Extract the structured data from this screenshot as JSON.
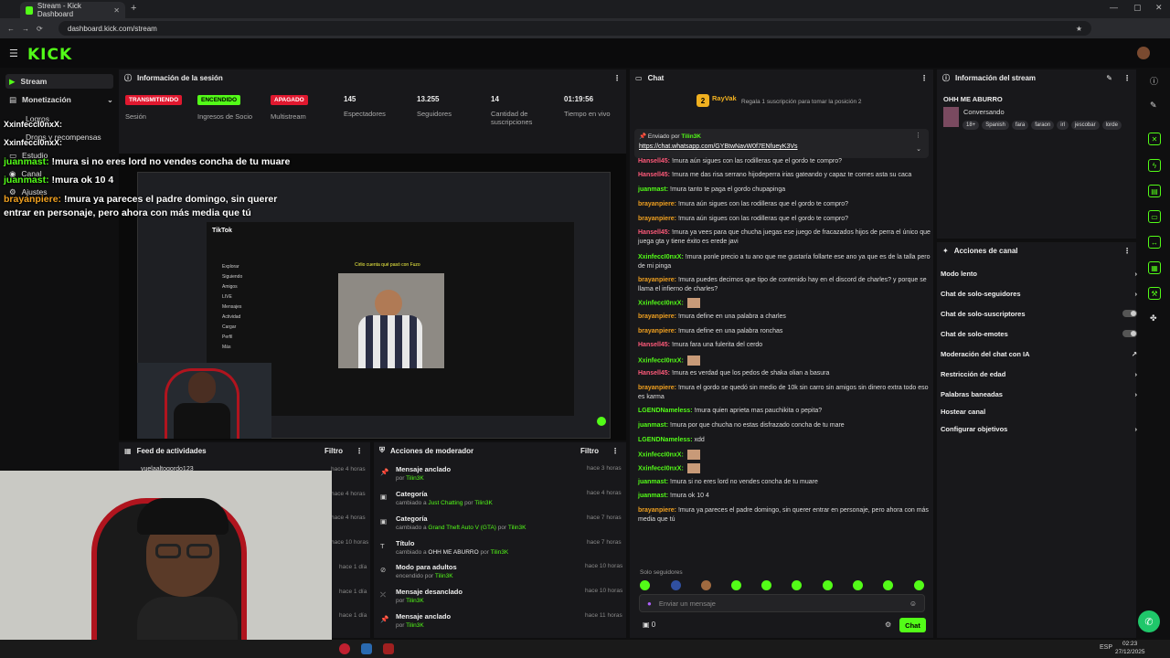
{
  "browser": {
    "tab_title": "Stream - Kick Dashboard",
    "url": "dashboard.kick.com/stream",
    "clock": "02:23",
    "date": "27/12/2025",
    "lang": "ESP"
  },
  "brand": {
    "logo": "KICK",
    "accent": "#53fc18"
  },
  "sidebar": {
    "items": [
      {
        "label": "Stream",
        "icon": "home-icon"
      },
      {
        "label": "Monetización",
        "icon": "dollar-icon"
      },
      {
        "label": "Logros",
        "icon": "trophy-icon"
      },
      {
        "label": "Drops y recompensas",
        "icon": "gift-icon"
      },
      {
        "label": "Estudio",
        "icon": "video-icon"
      },
      {
        "label": "Canal",
        "icon": "user-icon"
      },
      {
        "label": "Ajustes",
        "icon": "gear-icon"
      }
    ]
  },
  "session": {
    "title": "Información de la sesión",
    "stats": [
      {
        "value": "TRANSMITIENDO",
        "label": "Sesión"
      },
      {
        "value": "ENCENDIDO",
        "label": "Ingresos de Socio"
      },
      {
        "value": "APAGADO",
        "label": "Multistream"
      },
      {
        "value": "145",
        "label": "Espectadores"
      },
      {
        "value": "13.255",
        "label": "Seguidores"
      },
      {
        "value": "14",
        "label": "Cantidad de suscripciones"
      },
      {
        "value": "01:19:56",
        "label": "Tiempo en vivo"
      }
    ]
  },
  "overlay": [
    {
      "user": "XxinfeccI0nxX:",
      "text": ""
    },
    {
      "user": "XxinfeccI0nxX:",
      "text": ""
    },
    {
      "user": "juanmast:",
      "text": "!mura si no eres lord no vendes concha de tu muare"
    },
    {
      "user": "juanmast:",
      "text": "!mura ok 10 4"
    },
    {
      "user": "brayanpiere:",
      "text": "!mura ya pareces el padre domingo, sin querer entrar en personaje, pero ahora con más media que tú"
    }
  ],
  "embedded": {
    "tiktok": "TikTok",
    "caption": "Cirlio cuenta qué pasó con Fuzo",
    "menu": [
      "Explorar",
      "Siguiendo",
      "Amigos",
      "LIVE",
      "Mensajes",
      "Actividad",
      "Cargar",
      "Perfil",
      "Más"
    ]
  },
  "feed": {
    "title": "Feed de actividades",
    "filter": "Filtro",
    "rows": [
      {
        "user": "vuelaaltogordo123",
        "time": "hace 4 horas"
      },
      {
        "user": "",
        "time": "hace 4 horas"
      },
      {
        "user": "",
        "time": "hace 4 horas"
      },
      {
        "user": "",
        "time": "hace 10 horas"
      },
      {
        "user": "",
        "time": "hace 1 día"
      },
      {
        "user": "",
        "time": "hace 1 día"
      },
      {
        "user": "",
        "time": "hace 1 día"
      }
    ]
  },
  "mod": {
    "title": "Acciones de moderador",
    "filter": "Filtro",
    "rows": [
      {
        "title": "Mensaje anclado",
        "pre": "por",
        "value": "",
        "by": "Tilin3K",
        "time": "hace 3 horas",
        "icon": "pin-icon"
      },
      {
        "title": "Categoría",
        "pre": "cambiado a",
        "value": "Just Chatting",
        "by": "Tilin3K",
        "time": "hace 4 horas",
        "icon": "category-icon"
      },
      {
        "title": "Categoría",
        "pre": "cambiado a",
        "value": "Grand Theft Auto V (GTA)",
        "by": "Tilin3K",
        "time": "hace 7 horas",
        "icon": "category-icon"
      },
      {
        "title": "Título",
        "pre": "cambiado a",
        "value": "OHH ME ABURRO",
        "by": "Tilin3K",
        "time": "hace 7 horas",
        "icon": "title-icon"
      },
      {
        "title": "Modo para adultos",
        "pre": "encendido por",
        "value": "",
        "by": "Tilin3K",
        "time": "hace 10 horas",
        "icon": "adult-icon"
      },
      {
        "title": "Mensaje desanclado",
        "pre": "por",
        "value": "",
        "by": "Tilin3K",
        "time": "hace 10 horas",
        "icon": "unpin-icon"
      },
      {
        "title": "Mensaje anclado",
        "pre": "por",
        "value": "",
        "by": "Tilin3K",
        "time": "hace 11 horas",
        "icon": "pin-icon"
      }
    ]
  },
  "chat": {
    "title": "Chat",
    "top_user": "RayVak",
    "top_count": "2",
    "sub_prompt": "Regala 1 suscripción para tomar la posición 2",
    "pinned_label": "Enviado por",
    "pinned_by": "Tilin3K",
    "pinned_link": "https://chat.whatsapp.com/GYBtwNavW0f7ENfueyK3Vs",
    "follower_mode": "Solo seguidores",
    "placeholder": "Enviar un mensaje",
    "send": "Chat",
    "count": "0",
    "messages": [
      {
        "user": "Hansell45:",
        "text": "!mura aún sigues con las rodilleras que el gordo te compro?",
        "color": "#ff5a7a"
      },
      {
        "user": "Hansell45:",
        "text": "!mura me das risa serrano hijodeperra irias gateando y capaz te comes asta su caca",
        "color": "#ff5a7a"
      },
      {
        "user": "juanmast:",
        "text": "!mura tanto te paga el gordo chupapinga",
        "color": "#53fc18"
      },
      {
        "user": "brayanpiere:",
        "text": "!mura aún sigues con las rodilleras que el gordo te compro?",
        "color": "#f0a020"
      },
      {
        "user": "brayanpiere:",
        "text": "!mura aún sigues con las rodilleras que el gordo te compro?",
        "color": "#f0a020"
      },
      {
        "user": "Hansell45:",
        "text": "!mura ya vees para que chucha juegas ese juego de fracazados hijos de perra el único que juega gta y tiene éxito es erede javi",
        "color": "#ff5a7a"
      },
      {
        "user": "XxinfeccI0nxX:",
        "text": "!mura ponle precio a tu ano que me gustaría follarte ese ano ya que es de la talla pero de mi pinga",
        "color": "#53fc18"
      },
      {
        "user": "brayanpiere:",
        "text": "!mura puedes decirnos que tipo de contenido hay en el discord de charles? y porque se llama el infierno de charles?",
        "color": "#f0a020"
      },
      {
        "user": "XxinfeccI0nxX:",
        "text": "",
        "color": "#53fc18"
      },
      {
        "user": "brayanpiere:",
        "text": "!mura define en una palabra a charles",
        "color": "#f0a020"
      },
      {
        "user": "brayanpiere:",
        "text": "!mura define en una palabra ronchas",
        "color": "#f0a020"
      },
      {
        "user": "Hansell45:",
        "text": "!mura fara una fulerita del cerdo",
        "color": "#ff5a7a"
      },
      {
        "user": "XxinfeccI0nxX:",
        "text": "",
        "color": "#53fc18"
      },
      {
        "user": "Hansell45:",
        "text": "!mura es verdad que los pedos de shaka olian a basura",
        "color": "#ff5a7a"
      },
      {
        "user": "brayanpiere:",
        "text": "!mura el gordo se quedó sin medio de 10k sin carro sin amigos sin dinero extra todo eso es karma",
        "color": "#f0a020"
      },
      {
        "user": "LGENDNameless:",
        "text": "!mura quien aprieta mas pauchikita o pepita?",
        "color": "#53fc18"
      },
      {
        "user": "juanmast:",
        "text": "!mura por que chucha no estas disfrazado concha de tu mare",
        "color": "#53fc18"
      },
      {
        "user": "LGENDNameless:",
        "text": "xdd",
        "color": "#53fc18"
      },
      {
        "user": "XxinfeccI0nxX:",
        "text": "",
        "color": "#53fc18"
      },
      {
        "user": "XxinfeccI0nxX:",
        "text": "",
        "color": "#53fc18"
      },
      {
        "user": "juanmast:",
        "text": "!mura si no eres lord no vendes concha de tu muare",
        "color": "#53fc18"
      },
      {
        "user": "juanmast:",
        "text": "!mura ok 10 4",
        "color": "#53fc18"
      },
      {
        "user": "brayanpiere:",
        "text": "!mura ya pareces el padre domingo, sin querer entrar en personaje, pero ahora con más media que tú",
        "color": "#f0a020"
      }
    ]
  },
  "stream_info": {
    "title": "Información del stream",
    "stream_title": "OHH ME ABURRO",
    "category": "Conversando",
    "tags": [
      "18+",
      "Spanish",
      "fara",
      "faraon",
      "irl",
      "jescobar",
      "lorde"
    ]
  },
  "channel_actions": {
    "title": "Acciones de canal",
    "items": [
      {
        "label": "Modo lento",
        "kind": "arrow"
      },
      {
        "label": "Chat de solo-seguidores",
        "kind": "arrow"
      },
      {
        "label": "Chat de solo-suscriptores",
        "kind": "toggle"
      },
      {
        "label": "Chat de solo-emotes",
        "kind": "toggle"
      },
      {
        "label": "Moderación del chat con IA",
        "kind": "link"
      },
      {
        "label": "Restricción de edad",
        "kind": "arrow"
      },
      {
        "label": "Palabras baneadas",
        "kind": "arrow"
      },
      {
        "label": "Hostear canal",
        "kind": "none"
      },
      {
        "label": "Configurar objetivos",
        "kind": "arrow"
      }
    ]
  }
}
